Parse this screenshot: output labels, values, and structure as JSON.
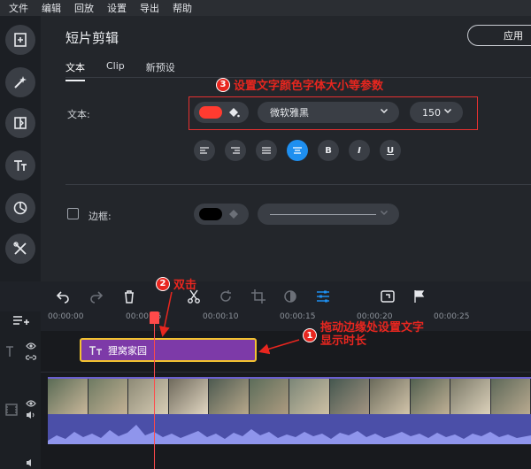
{
  "menu": [
    "文件",
    "编辑",
    "回放",
    "设置",
    "导出",
    "帮助"
  ],
  "panel": {
    "title": "短片剪辑",
    "apply_label": "应用",
    "tabs": [
      "文本",
      "Clip",
      "新预设"
    ],
    "text_label": "文本:",
    "font_name": "微软雅黑",
    "font_size": "150",
    "border_label": "边框:",
    "text_color": "#ff3b30",
    "border_color": "#000000",
    "align_buttons": [
      "align-left",
      "align-right",
      "align-justify",
      "align-center",
      "B",
      "I",
      "U"
    ]
  },
  "annotations": {
    "a3": {
      "num": "3",
      "text": "设置文字颜色字体大小等参数"
    },
    "a2": {
      "num": "2",
      "text": "双击"
    },
    "a1": {
      "num": "1",
      "text_line1": "拖动边缘处设置文字",
      "text_line2": "显示时长"
    }
  },
  "timeline": {
    "ruler_ticks": [
      "00:00:00",
      "00:00:05",
      "00:00:10",
      "00:00:15",
      "00:00:20",
      "00:00:25"
    ],
    "text_clip_label": "狸窝家园",
    "playhead_time": "00:00:05"
  },
  "colors": {
    "accent": "#1e8ff0",
    "clip_purple": "#7d3aa8",
    "clip_border": "#f2c230",
    "annotation_red": "#e8261f"
  }
}
